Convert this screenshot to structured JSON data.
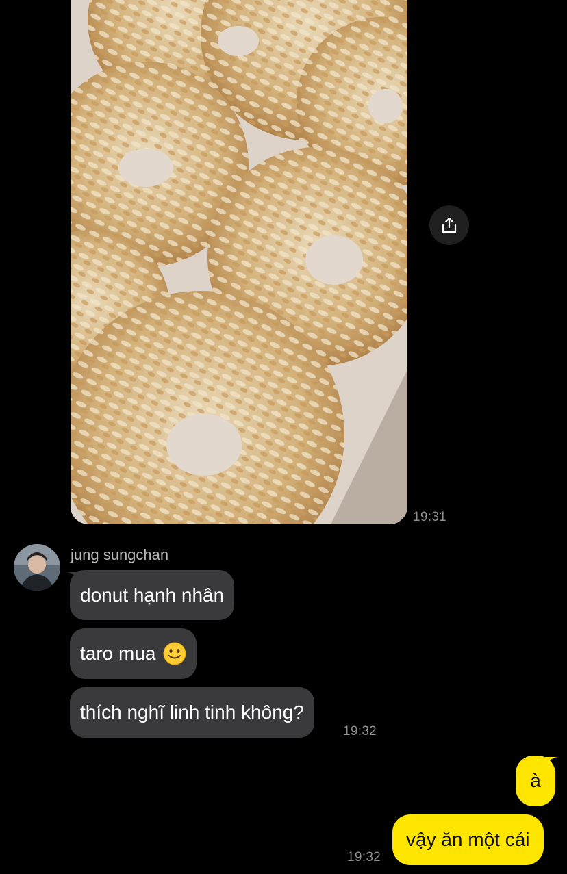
{
  "conversation": {
    "photo_message": {
      "time": "19:31"
    },
    "share_icon": "share-icon",
    "incoming": {
      "sender_name": "jung sungchan",
      "messages": [
        {
          "text": "donut hạnh nhân"
        },
        {
          "text": "taro mua",
          "emoji": "slightly-smiling-face-icon"
        },
        {
          "text": "thích nghĩ linh tinh không?"
        }
      ],
      "time": "19:32"
    },
    "outgoing": {
      "messages": [
        {
          "text": "à"
        },
        {
          "text": "vậy ăn một cái"
        }
      ],
      "time": "19:32"
    }
  },
  "colors": {
    "background": "#000000",
    "incoming_bubble": "#3a3a3c",
    "outgoing_bubble": "#fee500",
    "timestamp": "#8e8e8e"
  }
}
